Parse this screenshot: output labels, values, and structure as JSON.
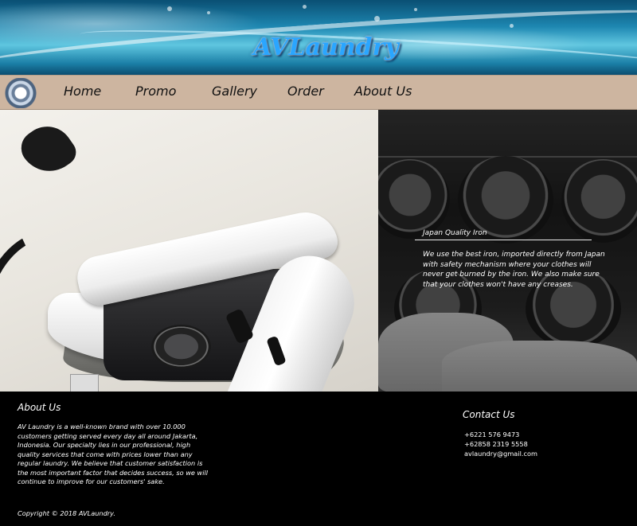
{
  "brand": {
    "logo_text": "AVLaundry"
  },
  "nav": {
    "items": [
      {
        "label": "Home"
      },
      {
        "label": "Promo"
      },
      {
        "label": "Gallery"
      },
      {
        "label": "Order"
      },
      {
        "label": "About Us"
      }
    ]
  },
  "hero": {
    "caption_title": "Japan Quality Iron",
    "caption_text": "We use the best iron, imported directly from Japan with safety mechanism where your clothes will never get burned by the iron. We also make sure that your clothes won't have any creases."
  },
  "footer": {
    "about_heading": "About Us",
    "about_text": "AV Laundry is a well-known brand with over 10.000 customers getting served every day all around Jakarta, Indonesia. Our specialty lies in our professional, high quality services that come with prices lower than any regular laundry. We believe that customer satisfaction is the most important factor that decides success, so we will continue to improve for our customers' sake.",
    "copyright": "Copyright © 2018 AVLaundry.",
    "contact_heading": "Contact Us",
    "contacts": [
      "+6221 576 9473",
      "+62858 2319 5558",
      "avlaundry@gmail.com"
    ]
  },
  "colors": {
    "navbar": "#cdb5a0",
    "footer": "#000000",
    "logo": "#2aa6ff"
  }
}
